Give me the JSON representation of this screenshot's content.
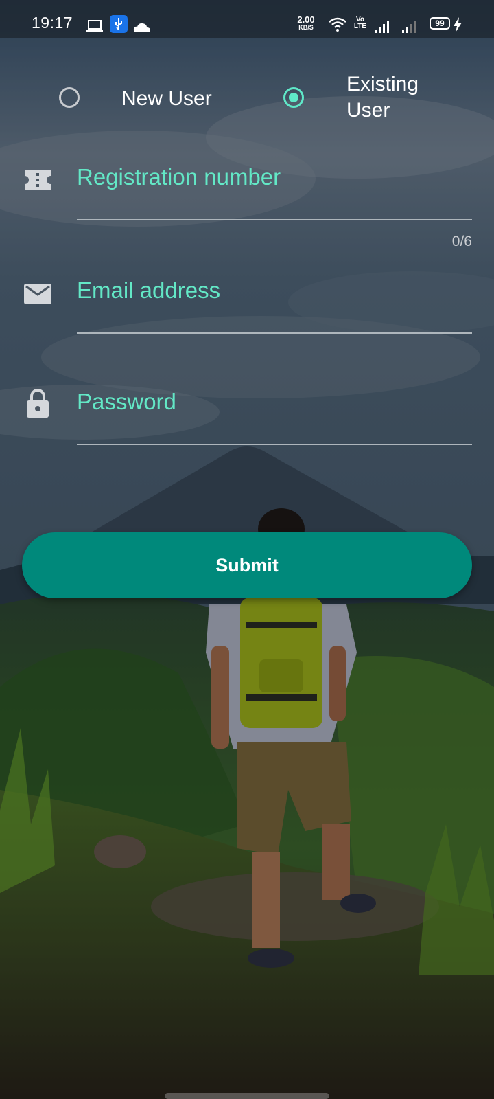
{
  "status_bar": {
    "time": "19:17",
    "net_speed": "2.00",
    "net_speed_unit": "KB/S",
    "volte": "Vo LTE",
    "battery": "99",
    "left_icons": [
      "laptop-icon",
      "usb-icon",
      "cloud-icon"
    ],
    "right_icons": [
      "wifi-icon",
      "signal-icon",
      "signal-weak-icon",
      "charging-icon"
    ]
  },
  "user_type": {
    "options": [
      {
        "label": "New User",
        "selected": false
      },
      {
        "label": "Existing User",
        "selected": true
      }
    ]
  },
  "form": {
    "registration": {
      "placeholder": "Registration number",
      "value": "",
      "counter": "0/6",
      "icon": "ticket-icon"
    },
    "email": {
      "placeholder": "Email address",
      "value": "",
      "icon": "email-icon"
    },
    "password": {
      "placeholder": "Password",
      "value": "",
      "icon": "lock-icon"
    },
    "submit_label": "Submit"
  },
  "colors": {
    "accent": "#5fe8c8",
    "button": "#00897b",
    "underline": "#aeb6bc"
  }
}
